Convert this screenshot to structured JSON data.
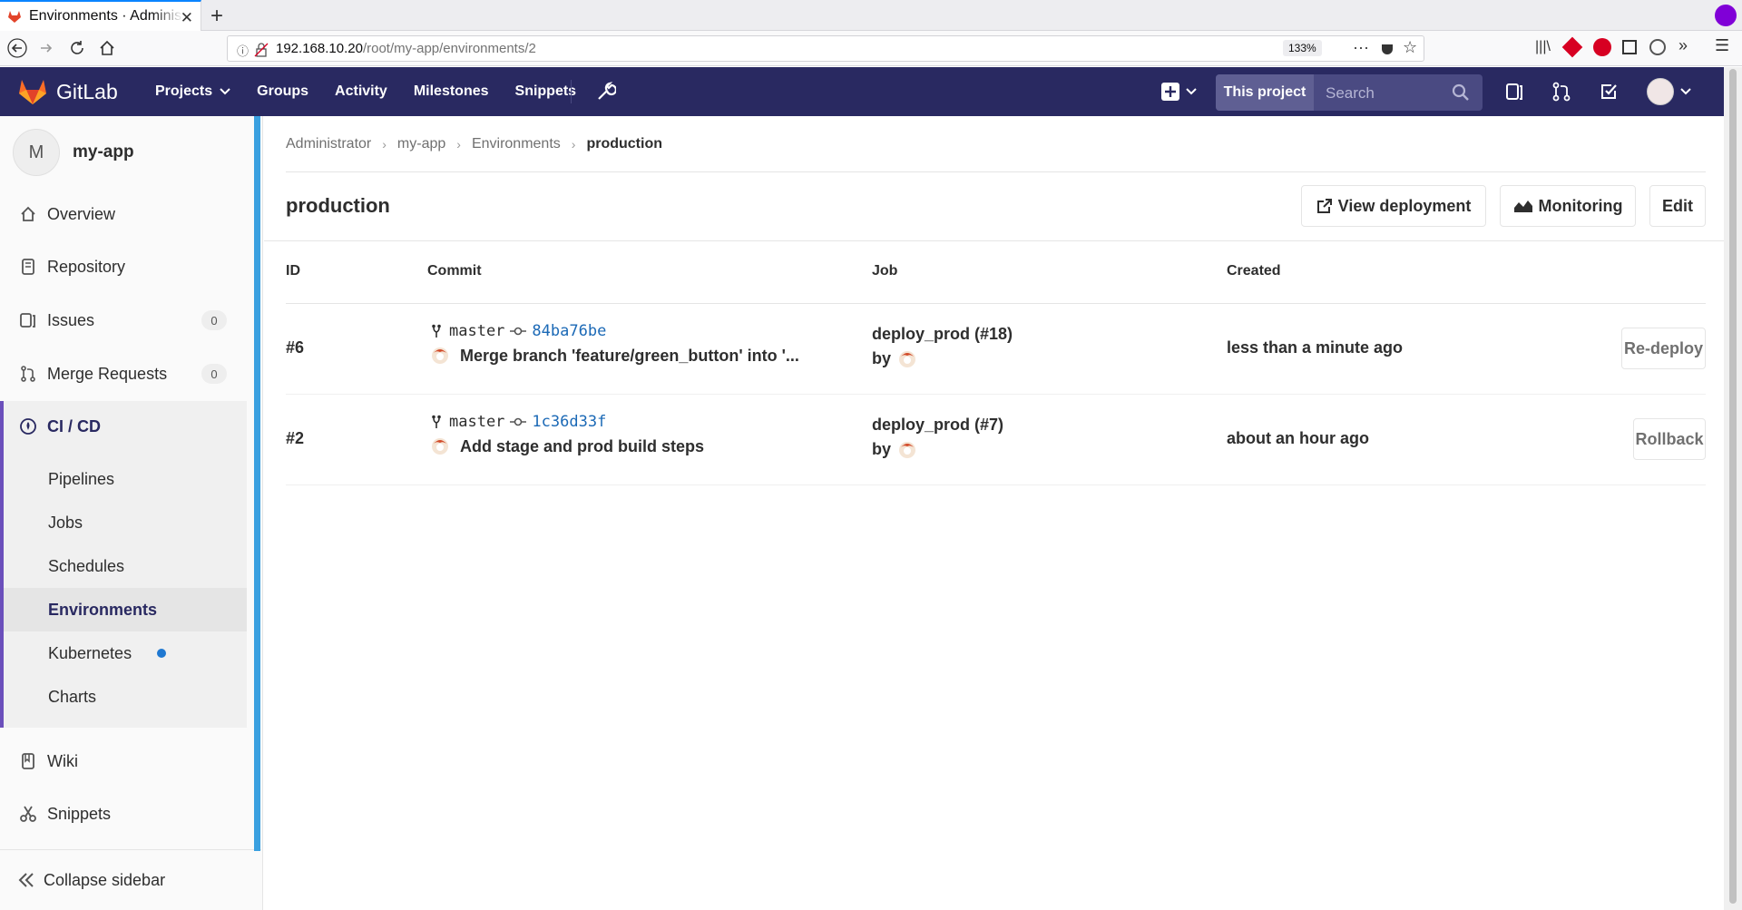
{
  "browser": {
    "tab_title": "Environments · Administrator / my-app · GitLab",
    "url_host": "192.168.10.20",
    "url_path": "/root/my-app/environments/2",
    "zoom": "133%"
  },
  "header": {
    "logo_text": "GitLab",
    "nav": [
      "Projects",
      "Groups",
      "Activity",
      "Milestones",
      "Snippets"
    ],
    "search_scope": "This project",
    "search_placeholder": "Search"
  },
  "sidebar": {
    "project_initial": "M",
    "project_name": "my-app",
    "items": [
      {
        "label": "Overview"
      },
      {
        "label": "Repository"
      },
      {
        "label": "Issues",
        "badge": "0"
      },
      {
        "label": "Merge Requests",
        "badge": "0"
      }
    ],
    "ci": {
      "label": "CI / CD",
      "sub": [
        "Pipelines",
        "Jobs",
        "Schedules",
        "Environments",
        "Kubernetes",
        "Charts"
      ]
    },
    "after": [
      {
        "label": "Wiki"
      },
      {
        "label": "Snippets"
      }
    ],
    "collapse_label": "Collapse sidebar"
  },
  "breadcrumbs": [
    "Administrator",
    "my-app",
    "Environments",
    "production"
  ],
  "page": {
    "title": "production",
    "buttons": {
      "view_deployment": "View deployment",
      "monitoring": "Monitoring",
      "edit": "Edit"
    }
  },
  "table": {
    "headers": [
      "ID",
      "Commit",
      "Job",
      "Created"
    ],
    "rows": [
      {
        "id": "#6",
        "branch": "master",
        "sha": "84ba76be",
        "message": "Merge branch 'feature/green_button' into '...",
        "job": "deploy_prod (#18)",
        "by": "by",
        "created": "less than a minute ago",
        "action": "Re-deploy"
      },
      {
        "id": "#2",
        "branch": "master",
        "sha": "1c36d33f",
        "message": "Add stage and prod build steps",
        "job": "deploy_prod (#7)",
        "by": "by",
        "created": "about an hour ago",
        "action": "Rollback"
      }
    ]
  },
  "colors": {
    "header_bg": "#292961",
    "accent": "#6b4fbb",
    "link": "#1b69b6"
  }
}
